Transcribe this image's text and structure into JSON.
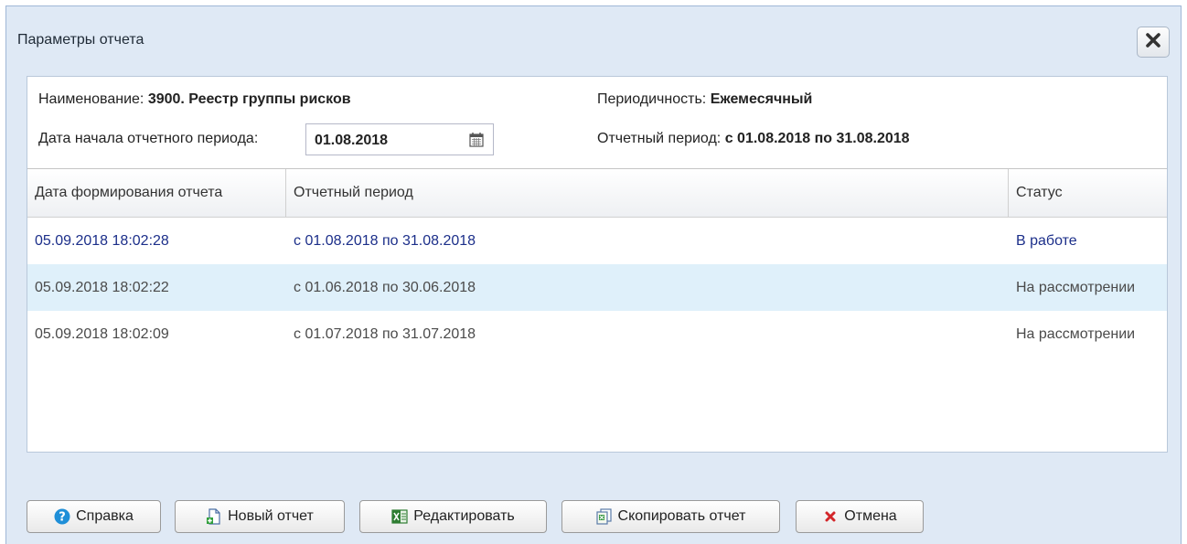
{
  "window": {
    "title": "Параметры отчета"
  },
  "info": {
    "name_label": "Наименование:",
    "name_value": "3900. Реестр группы рисков",
    "periodicity_label": "Периодичность:",
    "periodicity_value": "Ежемесячный",
    "start_date_label": "Дата начала отчетного периода:",
    "start_date_value": "01.08.2018",
    "period_label": "Отчетный период:",
    "period_value": "с 01.08.2018 по 31.08.2018"
  },
  "grid": {
    "columns": [
      "Дата формирования отчета",
      "Отчетный период",
      "Статус"
    ],
    "rows": [
      {
        "date": "05.09.2018 18:02:28",
        "period": "с 01.08.2018 по 31.08.2018",
        "status": "В работе"
      },
      {
        "date": "05.09.2018 18:02:22",
        "period": "с 01.06.2018 по 30.06.2018",
        "status": "На рассмотрении"
      },
      {
        "date": "05.09.2018 18:02:09",
        "period": "с 01.07.2018 по 31.07.2018",
        "status": "На рассмотрении"
      }
    ]
  },
  "buttons": {
    "help": "Справка",
    "new_report": "Новый отчет",
    "edit": "Редактировать",
    "copy_report": "Скопировать отчет",
    "cancel": "Отмена"
  },
  "icons": {
    "close": "close-icon",
    "calendar": "calendar-icon",
    "help": "help-icon",
    "new_report": "new-document-icon",
    "edit": "excel-icon",
    "copy": "copy-icon",
    "cancel": "cancel-icon"
  },
  "colors": {
    "dialog_bg": "#dfe9f5",
    "selected_row": "#dff0fa",
    "link_text": "#1c2f8a"
  }
}
